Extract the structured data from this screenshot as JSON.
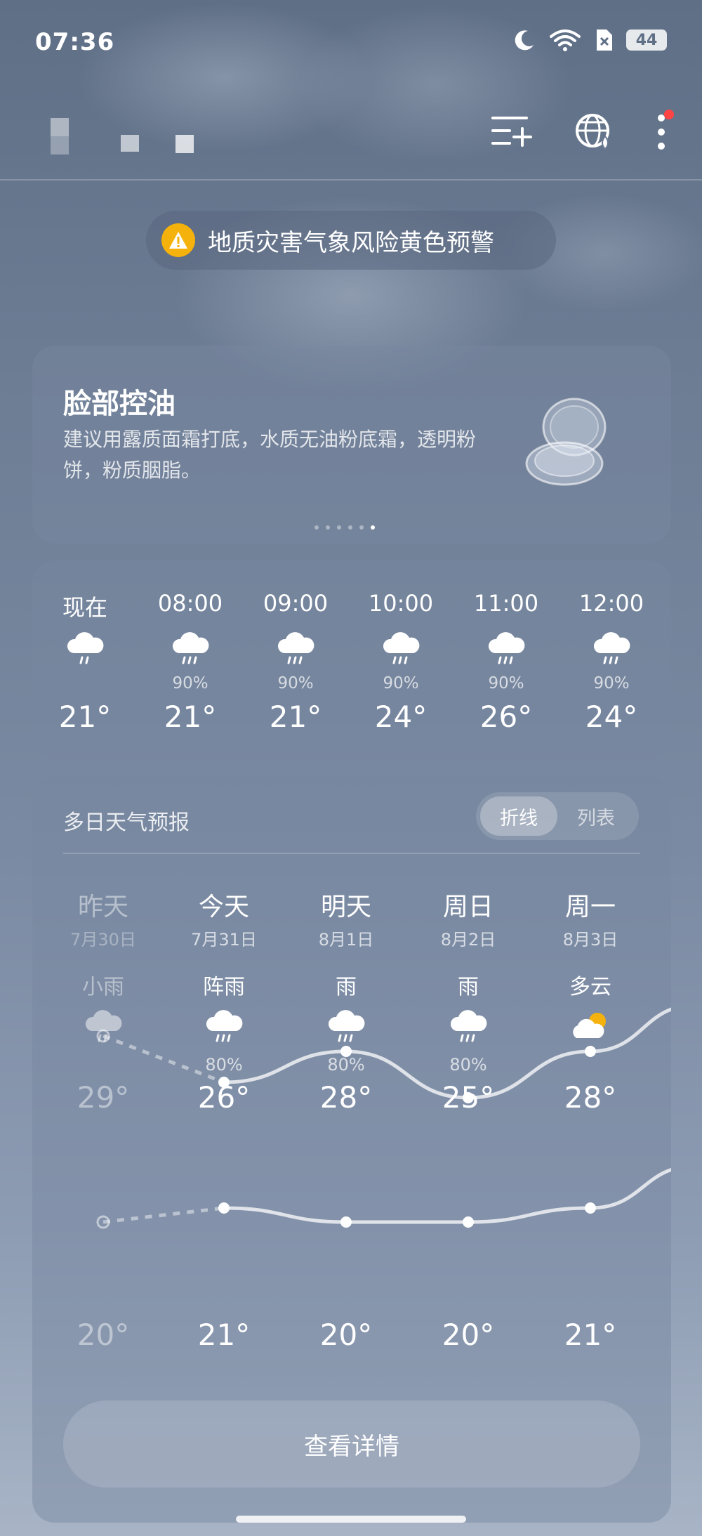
{
  "status_bar": {
    "time": "07:36",
    "battery": "44",
    "icons": [
      "moon-icon",
      "wifi-icon",
      "sim-off-icon",
      "battery-icon"
    ]
  },
  "header": {
    "icons": [
      "city-manage-icon",
      "globe-icon",
      "more-icon"
    ],
    "has_notification_dot": true
  },
  "alert": {
    "text": "地质灾害气象风险黄色预警",
    "color": "#f6b20c"
  },
  "tip": {
    "title": "脸部控油",
    "description": "建议用露质面霜打底，水质无油粉底霜，透明粉饼，粉质胭脂。",
    "page_count": 7,
    "active_page": 6
  },
  "hourly": [
    {
      "time": "现在",
      "pop": "",
      "temp": "21°"
    },
    {
      "time": "08:00",
      "pop": "90%",
      "temp": "21°"
    },
    {
      "time": "09:00",
      "pop": "90%",
      "temp": "21°"
    },
    {
      "time": "10:00",
      "pop": "90%",
      "temp": "24°"
    },
    {
      "time": "11:00",
      "pop": "90%",
      "temp": "26°"
    },
    {
      "time": "12:00",
      "pop": "90%",
      "temp": "24°"
    }
  ],
  "daily": {
    "title": "多日天气预报",
    "toggle": {
      "line": "折线",
      "list": "列表",
      "selected": "折线"
    },
    "days": [
      {
        "name": "昨天",
        "date": "7月30日",
        "condition": "小雨",
        "pop": "",
        "high": "29°",
        "low": "20°",
        "icon": "light-rain-icon"
      },
      {
        "name": "今天",
        "date": "7月31日",
        "condition": "阵雨",
        "pop": "80%",
        "high": "26°",
        "low": "21°",
        "icon": "shower-icon"
      },
      {
        "name": "明天",
        "date": "8月1日",
        "condition": "雨",
        "pop": "80%",
        "high": "28°",
        "low": "20°",
        "icon": "rain-icon"
      },
      {
        "name": "周日",
        "date": "8月2日",
        "condition": "雨",
        "pop": "80%",
        "high": "25°",
        "low": "20°",
        "icon": "rain-icon"
      },
      {
        "name": "周一",
        "date": "8月3日",
        "condition": "多云",
        "pop": "",
        "high": "28°",
        "low": "21°",
        "icon": "partly-cloudy-icon"
      }
    ],
    "details_button": "查看详情"
  }
}
